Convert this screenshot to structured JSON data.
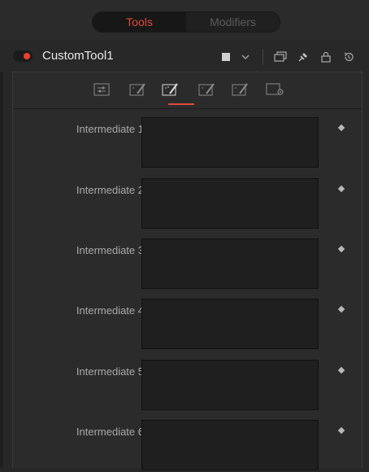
{
  "top_tabs": {
    "tools": "Tools",
    "modifiers": "Modifiers"
  },
  "tool": {
    "name": "CustomTool1",
    "enabled": true,
    "accent": "#e8412f"
  },
  "header_icons": [
    "color-swatch-icon",
    "chevron-down-icon",
    "copy-window-icon",
    "pin-icon",
    "lock-icon",
    "reset-icon"
  ],
  "panel_tabs": [
    {
      "name": "controls-tab",
      "active": false
    },
    {
      "name": "intermediate-tab-1",
      "active": false
    },
    {
      "name": "intermediate-tab-2",
      "active": true
    },
    {
      "name": "intermediate-tab-3",
      "active": false
    },
    {
      "name": "intermediate-tab-4",
      "active": false
    },
    {
      "name": "settings-tab",
      "active": false
    }
  ],
  "fields": [
    {
      "label": "Intermediate 1",
      "value": ""
    },
    {
      "label": "Intermediate 2",
      "value": ""
    },
    {
      "label": "Intermediate 3",
      "value": ""
    },
    {
      "label": "Intermediate 4",
      "value": ""
    },
    {
      "label": "Intermediate 5",
      "value": ""
    },
    {
      "label": "Intermediate 6",
      "value": ""
    }
  ]
}
